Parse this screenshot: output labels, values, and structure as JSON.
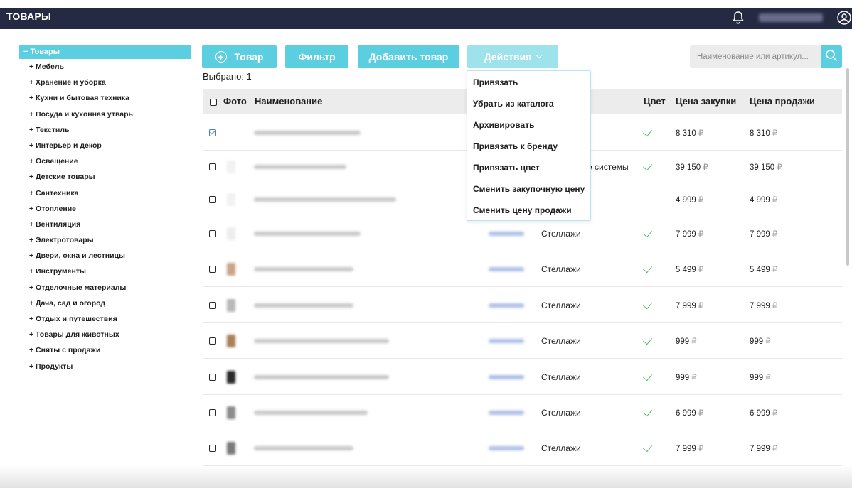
{
  "header": {
    "title": "ТОВАРЫ"
  },
  "sidebar": {
    "root": "− Товары",
    "items": [
      "+ Мебель",
      "+ Хранение и уборка",
      "+ Кухни и бытовая техника",
      "+ Посуда и кухонная утварь",
      "+ Текстиль",
      "+ Интерьер и декор",
      "+ Освещение",
      "+ Детские товары",
      "+ Сантехника",
      "+ Отопление",
      "+ Вентиляция",
      "+ Электротовары",
      "+ Двери, окна и лестницы",
      "+ Инструменты",
      "+ Отделочные материалы",
      "+ Дача, сад и огород",
      "+ Отдых и путешествия",
      "+ Товары для животных",
      "+ Сняты с продажи",
      "+ Продукты"
    ]
  },
  "toolbar": {
    "add_label": "Товар",
    "filter_label": "Фильтр",
    "add_product_label": "Добавить товар",
    "actions_label": "Действия",
    "selected_text": "Выбрано: 1",
    "search_placeholder": "Наименование или артикул..."
  },
  "actions_menu": [
    "Привязать",
    "Убрать из каталога",
    "Архивировать",
    "Привязать к бренду",
    "Привязать цвет",
    "Сменить закупочную цену",
    "Сменить цену продажи"
  ],
  "table": {
    "columns": {
      "photo": "Фото",
      "name": "Наименование",
      "color": "Цвет",
      "buy_price": "Цена закупки",
      "sell_price": "Цена продажи"
    },
    "currency": "₽",
    "rows": [
      {
        "checked": true,
        "brand": "",
        "color": true,
        "buy": "8 310",
        "sell": "8 310"
      },
      {
        "checked": false,
        "brand": "е системы",
        "color": true,
        "buy": "39 150",
        "sell": "39 150"
      },
      {
        "checked": false,
        "brand": "",
        "color": false,
        "buy": "4 999",
        "sell": "4 999"
      },
      {
        "checked": false,
        "brand": "Стеллажи",
        "color": true,
        "buy": "7 999",
        "sell": "7 999"
      },
      {
        "checked": false,
        "brand": "Стеллажи",
        "color": true,
        "buy": "5 499",
        "sell": "5 499"
      },
      {
        "checked": false,
        "brand": "Стеллажи",
        "color": true,
        "buy": "7 999",
        "sell": "7 999"
      },
      {
        "checked": false,
        "brand": "Стеллажи",
        "color": true,
        "buy": "999",
        "sell": "999"
      },
      {
        "checked": false,
        "brand": "Стеллажи",
        "color": true,
        "buy": "999",
        "sell": "999"
      },
      {
        "checked": false,
        "brand": "Стеллажи",
        "color": true,
        "buy": "6 999",
        "sell": "6 999"
      },
      {
        "checked": false,
        "brand": "Стеллажи",
        "color": true,
        "buy": "7 999",
        "sell": "7 999"
      }
    ]
  },
  "colors": {
    "header_bg": "#252a43",
    "accent": "#5bcfe0",
    "accent_light": "#9ee2ec",
    "check_green": "#3fb950"
  }
}
